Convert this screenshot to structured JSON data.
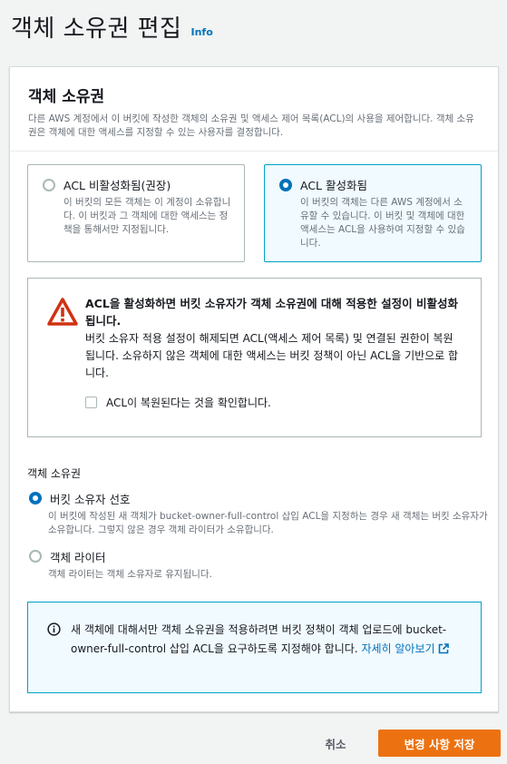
{
  "page": {
    "title": "객체 소유권 편집",
    "info_link": "Info"
  },
  "container": {
    "title": "객체 소유권",
    "description": "다른 AWS 계정에서 이 버킷에 작성한 객체의 소유권 및 액세스 제어 목록(ACL)의 사용을 제어합니다. 객체 소유권은 객체에 대한 액세스를 지정할 수 있는 사용자를 결정합니다."
  },
  "acl_tiles": [
    {
      "label": "ACL 비활성화됨(권장)",
      "description": "이 버킷의 모든 객체는 이 계정이 소유합니다. 이 버킷과 그 객체에 대한 액세스는 정책을 통해서만 지정됩니다.",
      "selected": false
    },
    {
      "label": "ACL 활성화됨",
      "description": "이 버킷의 객체는 다른 AWS 계정에서 소유할 수 있습니다. 이 버킷 및 객체에 대한 액세스는 ACL을 사용하여 지정할 수 있습니다.",
      "selected": true
    }
  ],
  "warning": {
    "title": "ACL을 활성화하면 버킷 소유자가 객체 소유권에 대해 적용한 설정이 비활성화됩니다.",
    "text": "버킷 소유자 적용 설정이 해제되면 ACL(액세스 제어 목록) 및 연결된 권한이 복원됩니다. 소유하지 않은 객체에 대한 액세스는 버킷 정책이 아닌 ACL을 기반으로 합니다.",
    "acknowledge_label": "ACL이 복원된다는 것을 확인합니다.",
    "acknowledged": false
  },
  "ownership": {
    "label": "객체 소유권",
    "options": [
      {
        "label": "버킷 소유자 선호",
        "description": "이 버킷에 작성된 새 객체가 bucket-owner-full-control 삽입 ACL을 지정하는 경우 새 객체는 버킷 소유자가 소유합니다. 그렇지 않은 경우 객체 라이터가 소유합니다.",
        "selected": true
      },
      {
        "label": "객체 라이터",
        "description": "객체 라이터는 객체 소유자로 유지됩니다.",
        "selected": false
      }
    ]
  },
  "info_box": {
    "text": "새 객체에 대해서만 객체 소유권을 적용하려면 버킷 정책이 객체 업로드에 bucket-owner-full-control 삽입 ACL을 요구하도록 지정해야 합니다.",
    "link": "자세히 알아보기"
  },
  "actions": {
    "cancel": "취소",
    "save": "변경 사항 저장"
  },
  "colors": {
    "accent": "#0073bb",
    "primary_button": "#ec7211",
    "warning_icon": "#d13212",
    "info_border": "#00a1c9"
  }
}
